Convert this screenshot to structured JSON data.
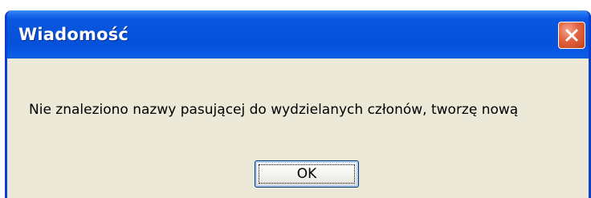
{
  "window": {
    "title": "Wiadomość",
    "close_icon": "close-x-icon"
  },
  "dialog": {
    "message": "Nie znaleziono nazwy pasującej do wydzielanych członów, tworzę nową",
    "ok_label": "OK"
  },
  "colors": {
    "titlebar": "#0753db",
    "window_border": "#0a3fd0",
    "body_background": "#ece9d8",
    "close_button": "#e2613f"
  }
}
